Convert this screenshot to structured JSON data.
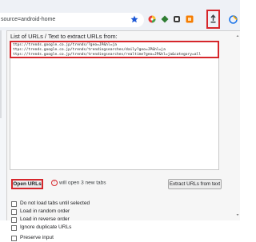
{
  "browser": {
    "address_text": "source=android-home"
  },
  "popup": {
    "label": "List of URLs / Text to extract URLs from:",
    "urls": [
      "ttps://trends.google.co.jp/trends/?geo=JP&hl=ja",
      "ttps://trends.google.co.jp/trends/trendingsearches/daily?geo=JP&hl=ja",
      "ttps://trends.google.co.jp/trends/trendingsearches/realtime?geo=JP&hl=ja&category=all"
    ],
    "open_button": "Open URLs",
    "info_icon": "!",
    "info_text": "will open 3 new tabs",
    "extract_button": "Extract URLs from text",
    "options": [
      "Do not load tabs until selected",
      "Load in random order",
      "Load in reverse order",
      "Ignore duplicate URLs"
    ],
    "preserve_input": "Preserve input"
  },
  "colors": {
    "highlight": "#d6262b",
    "toolbar_bg": "#eef1f6"
  }
}
